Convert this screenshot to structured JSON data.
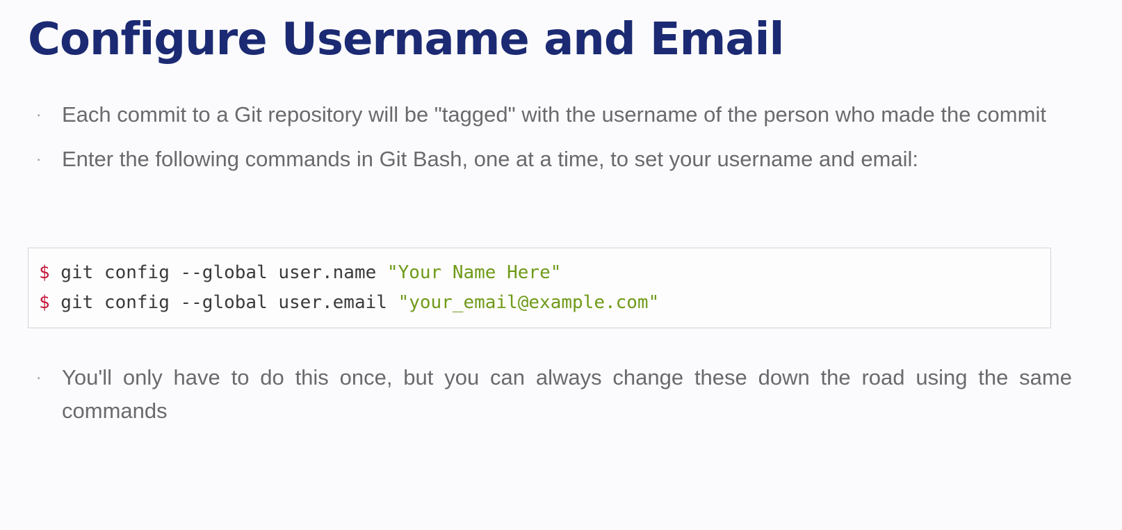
{
  "slide": {
    "title": "Configure Username and Email",
    "bullets_top": [
      {
        "marker": "·",
        "text": "Each commit to a Git repository will be \"tagged\" with the username of the person who made the commit"
      },
      {
        "marker": "·",
        "text": "Enter the following commands in Git Bash, one at a time, to set your username and email:"
      }
    ],
    "code": {
      "lines": [
        {
          "prompt": "$",
          "command": " git config --global user.name ",
          "string": "\"Your Name Here\""
        },
        {
          "prompt": "$",
          "command": " git config --global user.email ",
          "string": "\"your_email@example.com\""
        }
      ]
    },
    "bullets_bottom": [
      {
        "marker": "·",
        "text": "You'll only have to do this once, but you can always change these down the road using the same commands"
      }
    ]
  },
  "colors": {
    "title": "#1b2a72",
    "body_text": "#6a6a6e",
    "code_prompt": "#c4163a",
    "code_string": "#6f9a19",
    "code_text": "#3a3a3a",
    "background": "#fbfbfd"
  }
}
